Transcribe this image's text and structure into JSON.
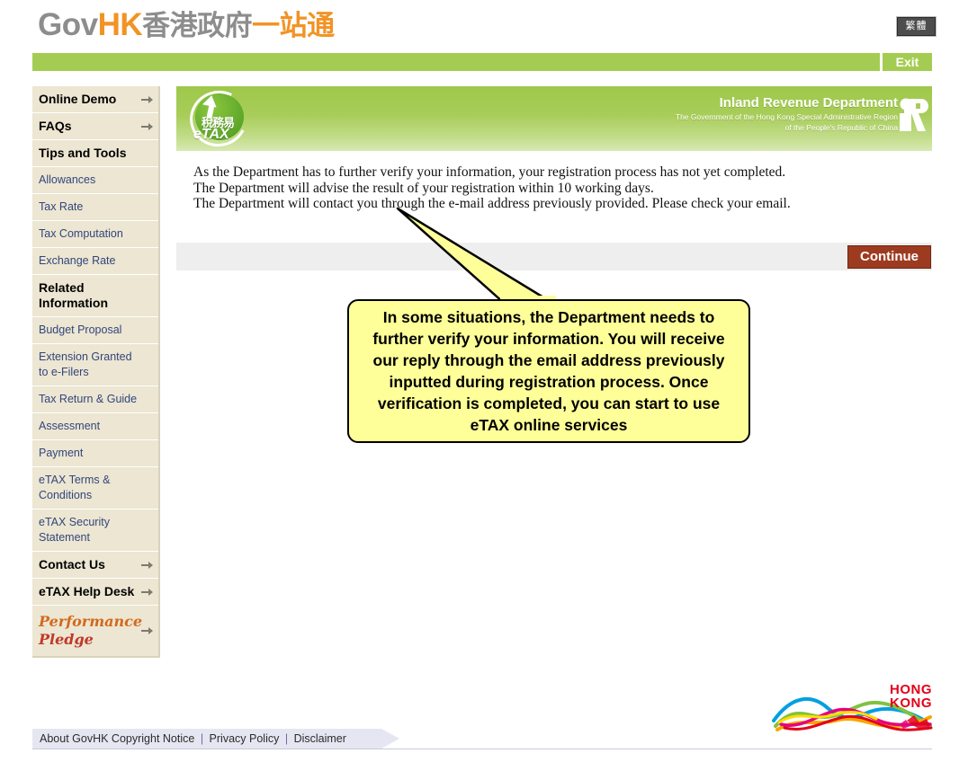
{
  "header": {
    "logo_gov": "Gov",
    "logo_hk": "HK",
    "logo_cn_gray": "香港政府",
    "logo_cn_orange": "一站通",
    "language_toggle": "繁體",
    "exit_label": "Exit"
  },
  "sidebar": {
    "items": [
      {
        "label": "Online Demo",
        "style": "bold",
        "arrow": true
      },
      {
        "label": "FAQs",
        "style": "bold",
        "arrow": true
      },
      {
        "label": "Tips and Tools",
        "style": "bold",
        "arrow": false
      },
      {
        "label": "Allowances",
        "style": "link",
        "arrow": false
      },
      {
        "label": "Tax Rate",
        "style": "link",
        "arrow": false
      },
      {
        "label": "Tax Computation",
        "style": "link",
        "arrow": false
      },
      {
        "label": "Exchange Rate",
        "style": "link",
        "arrow": false
      },
      {
        "label": "Related Information",
        "style": "bold",
        "arrow": false
      },
      {
        "label": "Budget Proposal",
        "style": "link",
        "arrow": false
      },
      {
        "label": "Extension Granted to e-Filers",
        "style": "link",
        "arrow": false
      },
      {
        "label": "Tax Return & Guide",
        "style": "link",
        "arrow": false
      },
      {
        "label": "Assessment",
        "style": "link",
        "arrow": false
      },
      {
        "label": "Payment",
        "style": "link",
        "arrow": false
      },
      {
        "label": "eTAX Terms & Conditions",
        "style": "link",
        "arrow": false
      },
      {
        "label": "eTAX Security Statement",
        "style": "link",
        "arrow": false
      },
      {
        "label": "Contact Us",
        "style": "bold",
        "arrow": true
      },
      {
        "label": "eTAX Help Desk",
        "style": "bold",
        "arrow": true
      },
      {
        "label": "Performance Pledge",
        "style": "script",
        "arrow": true,
        "word1": "Performance",
        "word2": "Pledge"
      }
    ]
  },
  "banner": {
    "etax_logo_cn": "稅務易",
    "etax_logo_text": "eTAX",
    "ird_title": "Inland Revenue Department",
    "ird_sub_line1": "The Government of the Hong Kong Special Administrative Region",
    "ird_sub_line2": "of the People's Republic of China",
    "ird_mark": "IR"
  },
  "main": {
    "paragraph_line1": "As the Department has to further verify your information, your registration process has not yet completed.",
    "paragraph_line2": "The Department will advise the result of your registration within 10 working days.",
    "paragraph_line3": "The Department will contact you through the e-mail address previously provided.  Please check your email.",
    "continue_label": "Continue"
  },
  "callout": {
    "text": "In some situations, the Department needs to further verify your information. You will receive our reply through the email address previously inputted during registration process. Once verification is completed, you can start to use eTAX online services",
    "background_color": "#ffff99",
    "border_color": "#000000"
  },
  "brand": {
    "hk_line1": "HONG",
    "hk_line2": "KONG",
    "hk_color": "#e2001a"
  },
  "footer": {
    "about": "About GovHK",
    "copyright": "Copyright Notice",
    "privacy": "Privacy Policy",
    "disclaimer": "Disclaimer",
    "separator": "|"
  },
  "colors": {
    "nav_green": "#a5cc52",
    "sidebar_beige": "#ece6d2",
    "continue_red": "#9d3b20",
    "link_blue": "#33457c",
    "accent_orange": "#f29326"
  }
}
